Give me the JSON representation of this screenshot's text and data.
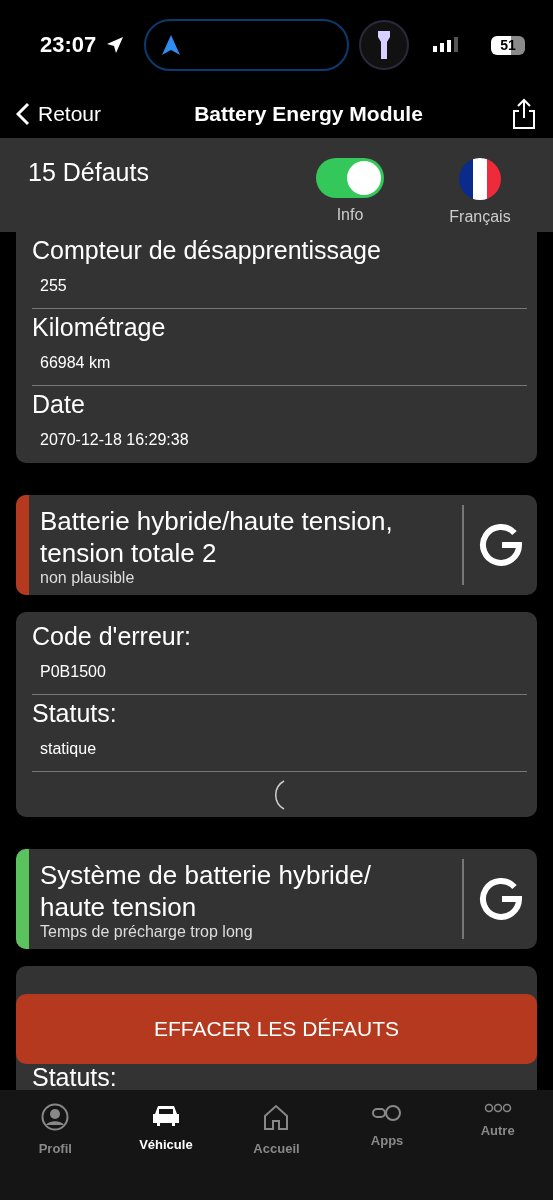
{
  "status_bar": {
    "time": "23:07",
    "battery": "51"
  },
  "nav": {
    "back": "Retour",
    "title": "Battery Energy Module"
  },
  "header": {
    "count": "15 Défauts",
    "info_toggle": {
      "label": "Info",
      "on": true
    },
    "language": {
      "label": "Français"
    }
  },
  "sections": [
    {
      "kind": "details",
      "cut_top": true,
      "loading": false,
      "rows": [
        {
          "label": "Compteur de désapprentissage",
          "value": "255"
        },
        {
          "label": "Kilométrage",
          "value": "66984 km"
        },
        {
          "label": "Date",
          "value": "2070-12-18 16:29:38"
        }
      ]
    },
    {
      "kind": "fault",
      "color": "#b5391e",
      "title": "Batterie hybride/haute tension, tension totale 2",
      "subtitle": "non plausible"
    },
    {
      "kind": "details",
      "cut_top": false,
      "loading": true,
      "rows": [
        {
          "label": "Code d'erreur:",
          "value": "P0B1500"
        },
        {
          "label": "Statuts:",
          "value": "statique"
        }
      ]
    },
    {
      "kind": "fault",
      "color": "#5ac35d",
      "title": "Système de batterie hybride/ haute tension",
      "subtitle": "Temps de précharge trop long"
    },
    {
      "kind": "details",
      "rows": [
        {
          "label": "Statuts:"
        }
      ]
    }
  ],
  "clear_button": "EFFACER LES DÉFAUTS",
  "tabs": [
    {
      "label": "Profil",
      "selected": false
    },
    {
      "label": "Véhicule",
      "selected": true
    },
    {
      "label": "Accueil",
      "selected": false
    },
    {
      "label": "Apps",
      "selected": false
    },
    {
      "label": "Autre",
      "selected": false
    }
  ]
}
